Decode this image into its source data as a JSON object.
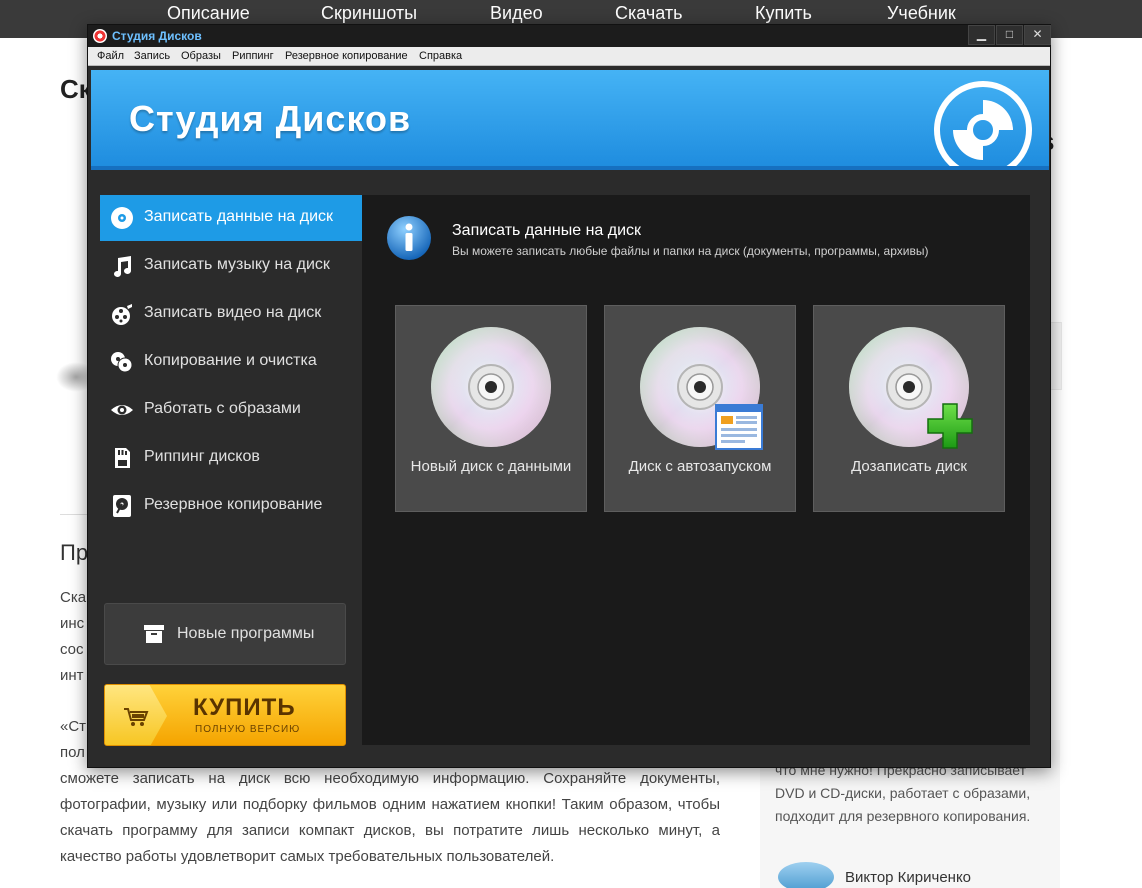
{
  "site": {
    "nav": [
      "Описание",
      "Скриншоты",
      "Видео",
      "Скачать",
      "Купить",
      "Учебник"
    ],
    "heading_left": "Ск",
    "heading_right": "s",
    "section_title": "Пр",
    "para_fragments": [
      "Ска",
      "инс",
      "сос",
      "инт"
    ],
    "para_start": "«Ст",
    "para_fragment_2": "пол",
    "paragraph": "сможете записать на диск всю необходимую информацию. Сохраняйте документы, фотографии, музыку или подборку фильмов одним нажатием кнопки! Таким образом, чтобы скачать программу для записи компакт дисков, вы потратите лишь несколько минут, а качество работы удовлетворит самых требовательных пользователей.",
    "review": "что мне нужно! Прекрасно записывает DVD и CD-диски, работает с образами, подходит для резервного копирования.",
    "author": "Виктор Кириченко"
  },
  "window": {
    "title": "Студия Дисков",
    "controls": [
      "▁",
      "□",
      "✕"
    ],
    "menu": [
      "Файл",
      "Запись",
      "Образы",
      "Риппинг",
      "Резервное копирование",
      "Справка"
    ],
    "banner_title": "Студия Дисков"
  },
  "sidebar": {
    "items": [
      {
        "label": "Записать данные на диск",
        "icon": "disc-icon",
        "active": true
      },
      {
        "label": "Записать музыку на диск",
        "icon": "music-note-icon",
        "active": false
      },
      {
        "label": "Записать видео на диск",
        "icon": "film-reel-icon",
        "active": false
      },
      {
        "label": "Копирование и очистка",
        "icon": "copy-discs-icon",
        "active": false
      },
      {
        "label": "Работать с образами",
        "icon": "eye-icon",
        "active": false
      },
      {
        "label": "Риппинг дисков",
        "icon": "sd-card-icon",
        "active": false
      },
      {
        "label": "Резервное копирование",
        "icon": "hard-drive-icon",
        "active": false
      }
    ],
    "new_programs": "Новые программы",
    "buy_main": "КУПИТЬ",
    "buy_sub": "ПОЛНУЮ ВЕРСИЮ"
  },
  "content": {
    "title": "Записать данные на диск",
    "subtitle": "Вы можете записать любые файлы и папки на диск (документы, программы, архивы)",
    "tiles": [
      {
        "label": "Новый диск с данными",
        "badge": "none"
      },
      {
        "label": "Диск с автозапуском",
        "badge": "window-icon"
      },
      {
        "label": "Дозаписать диск",
        "badge": "plus-icon"
      }
    ]
  },
  "colors": {
    "accent_blue": "#1e9be6",
    "buy_orange": "#f5a400",
    "panel_dark": "#1a1a1a",
    "window_bg": "#2b2b2b"
  }
}
